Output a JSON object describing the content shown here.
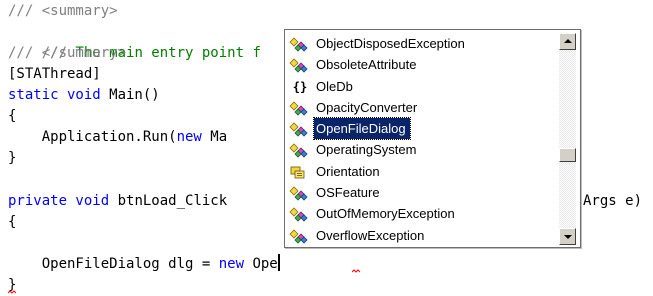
{
  "editor": {
    "lines": {
      "l1": "/// <summary>",
      "l2": "/// The main entry point f",
      "l3": "/// </summary>",
      "l4": "[STAThread]",
      "l5_kw": "static void",
      "l5_rest": " Main()",
      "l6": "{",
      "l7_pre": "    Application.Run(",
      "l7_kw": "new",
      "l7_post": " Ma",
      "l8": "}",
      "l10_kw": "private void",
      "l10_rest": " btnLoad_Click",
      "l10_tail": "Args e)",
      "l11": "{",
      "l12_pre": "    OpenFileDialog dlg = ",
      "l12_kw": "new",
      "l12_post": " Ope",
      "l13": "}"
    }
  },
  "intellisense": {
    "selected_index": 4,
    "items": [
      {
        "label": "ObjectDisposedException",
        "icon": "class-icon"
      },
      {
        "label": "ObsoleteAttribute",
        "icon": "class-icon"
      },
      {
        "label": "OleDb",
        "icon": "namespace-icon"
      },
      {
        "label": "OpacityConverter",
        "icon": "class-icon"
      },
      {
        "label": "OpenFileDialog",
        "icon": "class-icon"
      },
      {
        "label": "OperatingSystem",
        "icon": "class-icon"
      },
      {
        "label": "Orientation",
        "icon": "enum-icon"
      },
      {
        "label": "OSFeature",
        "icon": "class-icon"
      },
      {
        "label": "OutOfMemoryException",
        "icon": "class-icon"
      },
      {
        "label": "OverflowException",
        "icon": "class-icon"
      }
    ],
    "namespace_glyph": "{}",
    "scroll_position": 0.6
  },
  "colors": {
    "comment_gray": "#808080",
    "comment_green": "#008000",
    "keyword": "#0000ff",
    "selection": "#0a246a"
  }
}
